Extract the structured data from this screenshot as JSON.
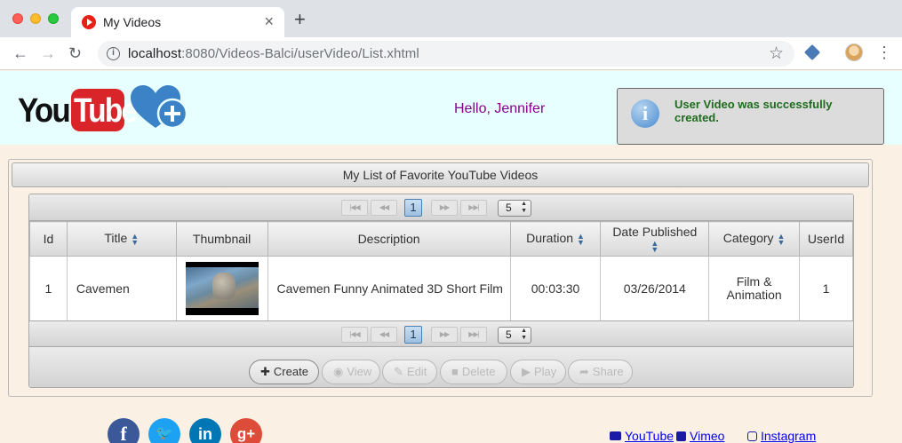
{
  "browser": {
    "tab_title": "My Videos",
    "url_host": "localhost",
    "url_path": ":8080/Videos-Balci/userVideo/List.xhtml"
  },
  "header": {
    "logo_you": "You",
    "logo_tube": "Tube",
    "greeting": "Hello, Jennifer",
    "message": "User Video was successfully created."
  },
  "panel": {
    "title": "My List of Favorite YouTube Videos"
  },
  "paginator": {
    "first": "|◀◀",
    "prev": "◀◀",
    "current_page": "1",
    "next": "▶▶",
    "last": "▶▶|",
    "rows_per_page": "5"
  },
  "table": {
    "columns": [
      "Id",
      "Title",
      "Thumbnail",
      "Description",
      "Duration",
      "Date Published",
      "Category",
      "UserId"
    ],
    "rows": [
      {
        "id": "1",
        "title": "Cavemen",
        "description": "Cavemen Funny Animated 3D Short Film",
        "duration": "00:03:30",
        "date_published": "03/26/2014",
        "category": "Film & Animation",
        "user_id": "1"
      }
    ]
  },
  "actions": {
    "create": "Create",
    "view": "View",
    "edit": "Edit",
    "delete": "Delete",
    "play": "Play",
    "share": "Share"
  },
  "footer": {
    "social": [
      "facebook-icon",
      "twitter-icon",
      "linkedin-icon",
      "google-plus-icon"
    ],
    "links": [
      "YouTube",
      "Vimeo",
      "Instagram"
    ]
  },
  "colors": {
    "header_bg": "#e8ffff",
    "page_bg": "#fbf0e4",
    "greeting": "#8b008b",
    "message_text": "#1f6b1f",
    "link": "#0000ee"
  }
}
